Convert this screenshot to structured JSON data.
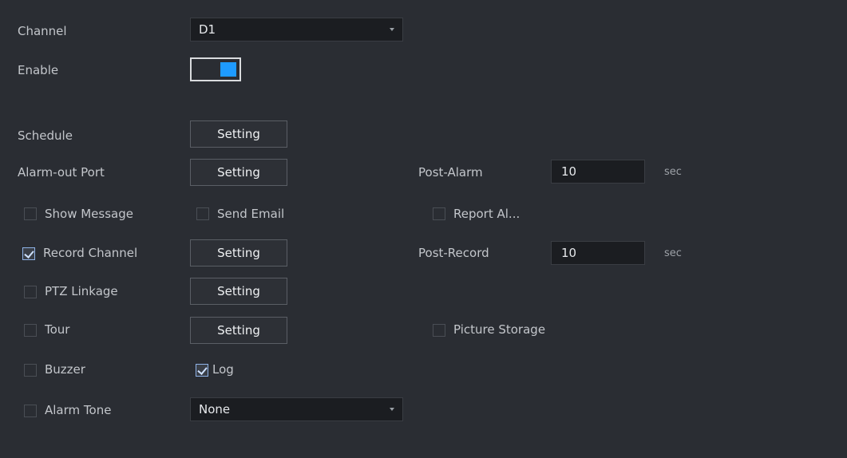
{
  "channel": {
    "label": "Channel",
    "value": "D1"
  },
  "enable": {
    "label": "Enable",
    "state": "on"
  },
  "schedule": {
    "label": "Schedule",
    "button": "Setting"
  },
  "alarm_out_port": {
    "label": "Alarm-out Port",
    "button": "Setting"
  },
  "post_alarm": {
    "label": "Post-Alarm",
    "value": "10",
    "unit": "sec"
  },
  "show_message": {
    "label": "Show Message",
    "checked": false
  },
  "send_email": {
    "label": "Send Email",
    "checked": false
  },
  "report_alarm": {
    "label": "Report Al...",
    "checked": false
  },
  "record_channel": {
    "label": "Record Channel",
    "checked": true,
    "button": "Setting"
  },
  "post_record": {
    "label": "Post-Record",
    "value": "10",
    "unit": "sec"
  },
  "ptz_linkage": {
    "label": "PTZ Linkage",
    "checked": false,
    "button": "Setting"
  },
  "tour": {
    "label": "Tour",
    "checked": false,
    "button": "Setting"
  },
  "picture_storage": {
    "label": "Picture Storage",
    "checked": false
  },
  "buzzer": {
    "label": "Buzzer",
    "checked": false
  },
  "log": {
    "label": "Log",
    "checked": true
  },
  "alarm_tone": {
    "label": "Alarm Tone",
    "checked": false,
    "value": "None"
  }
}
